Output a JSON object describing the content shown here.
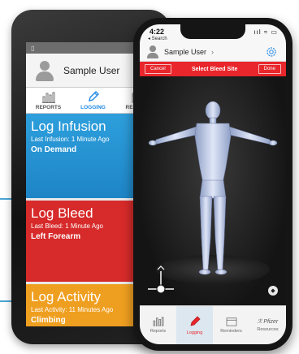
{
  "android": {
    "user_name": "Sample User",
    "tabs": [
      {
        "label": "REPORTS",
        "icon": "bar-chart-icon"
      },
      {
        "label": "LOGGING",
        "icon": "pencil-icon"
      },
      {
        "label": "REMINDE",
        "icon": "calendar-icon"
      }
    ],
    "tiles": {
      "infusion": {
        "title": "Log Infusion",
        "subtitle_prefix": "Last Infusion:",
        "subtitle_value": "1 Minute Ago",
        "value": "On Demand"
      },
      "bleed": {
        "title": "Log Bleed",
        "subtitle_prefix": "Last Bleed:",
        "subtitle_value": "1 Minute Ago",
        "value": "Left Forearm"
      },
      "activity": {
        "title": "Log Activity",
        "subtitle_prefix": "Last Activity:",
        "subtitle_value": "11 Minutes Ago",
        "value": "Climbing"
      }
    }
  },
  "iphone": {
    "time": "4:22",
    "back_label": "◂ Search",
    "user_name": "Sample User",
    "bar": {
      "cancel": "Cancel",
      "title": "Select Bleed Site",
      "done": "Done"
    },
    "tabs": [
      {
        "label": "Reports",
        "icon": "bar-chart-icon"
      },
      {
        "label": "Logging",
        "icon": "pencil-icon"
      },
      {
        "label": "Reminders",
        "icon": "calendar-icon"
      },
      {
        "label": "Resources",
        "icon": "pfizer-logo-icon"
      }
    ],
    "brand_text": "Pfizer"
  },
  "colors": {
    "infusion": "#1e85c6",
    "bleed": "#d72a2a",
    "activity": "#ef9f20",
    "accent_red": "#e8262b",
    "accent_blue": "#1e88e5"
  }
}
